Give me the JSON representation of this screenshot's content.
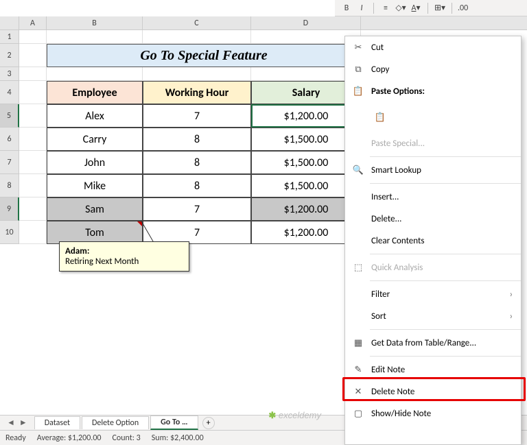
{
  "title": "Go To Special Feature",
  "columns": [
    "A",
    "B",
    "C",
    "D"
  ],
  "headers": {
    "employee": "Employee",
    "working_hour": "Working Hour",
    "salary": "Salary"
  },
  "rows": [
    {
      "n": 5,
      "emp": "Alex",
      "wh": "7",
      "sal": "$1,200.00",
      "sel": false,
      "active": true
    },
    {
      "n": 6,
      "emp": "Carry",
      "wh": "8",
      "sal": "$1,500.00",
      "sel": false
    },
    {
      "n": 7,
      "emp": "John",
      "wh": "8",
      "sal": "$1,500.00",
      "sel": false
    },
    {
      "n": 8,
      "emp": "Mike",
      "wh": "8",
      "sal": "$1,500.00",
      "sel": false
    },
    {
      "n": 9,
      "emp": "Sam",
      "wh": "7",
      "sal": "$1,200.00",
      "sel": true
    },
    {
      "n": 10,
      "emp": "Tom",
      "wh": "7",
      "sal": "$1,200.00",
      "sel": true
    }
  ],
  "comment": {
    "author": "Adam:",
    "text": "Retiring Next Month"
  },
  "tabs": {
    "items": [
      "Dataset",
      "Delete Option",
      "Go To …"
    ],
    "active": 2
  },
  "status": {
    "ready": "Ready",
    "avg": "Average: $1,200.00",
    "count": "Count: 3",
    "sum": "Sum: $2,400.00"
  },
  "context_menu": {
    "cut": "Cut",
    "copy": "Copy",
    "paste_options": "Paste Options:",
    "paste_special": "Paste Special...",
    "smart_lookup": "Smart Lookup",
    "insert": "Insert...",
    "delete": "Delete...",
    "clear": "Clear Contents",
    "quick_analysis": "Quick Analysis",
    "filter": "Filter",
    "sort": "Sort",
    "get_data": "Get Data from Table/Range...",
    "edit_note": "Edit Note",
    "delete_note": "Delete Note",
    "show_hide_note": "Show/Hide Note"
  },
  "watermark": "exceldemy"
}
